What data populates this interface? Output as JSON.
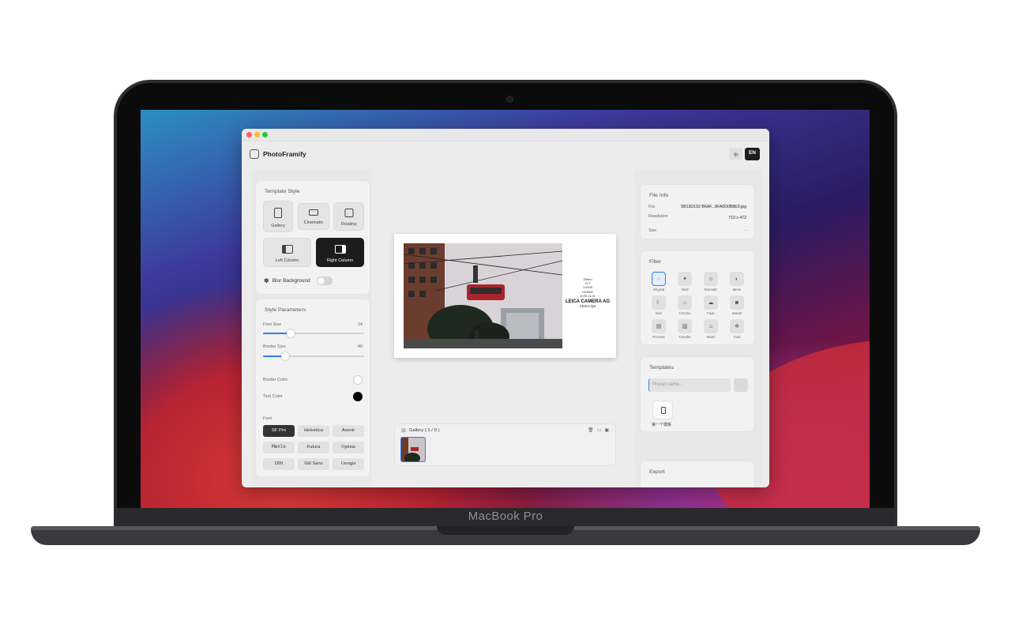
{
  "device": {
    "brand_label": "MacBook Pro"
  },
  "app": {
    "title": "PhotoFramify",
    "lang_zh": "中",
    "lang_en": "EN"
  },
  "template_style": {
    "title": "Template Style",
    "items": [
      {
        "label": "Gallery",
        "selected": false
      },
      {
        "label": "Cinematic",
        "selected": false
      },
      {
        "label": "Floating",
        "selected": false
      },
      {
        "label": "Left Column",
        "selected": false
      },
      {
        "label": "Right Column",
        "selected": true
      }
    ],
    "blur_label": "Blur Background",
    "blur_on": false
  },
  "style_params": {
    "title": "Style Parameters",
    "font_size_label": "Font Size",
    "font_size_value": "24",
    "font_size_fraction": 0.27,
    "border_size_label": "Border Size",
    "border_size_value": "40",
    "border_size_fraction": 0.22,
    "border_color_label": "Border Color",
    "border_color": "#ffffff",
    "text_color_label": "Text Color",
    "text_color": "#000000",
    "font_label": "Font",
    "fonts": [
      "SF Pro",
      "Helvetica",
      "Avenir",
      "Menlo",
      "Futura",
      "Optima",
      "DIN",
      "Gill Sans",
      "Georgia"
    ],
    "selected_font": "SF Pro"
  },
  "preview": {
    "focal": "28mm",
    "aperture": "f/17",
    "shutter": "1/1000",
    "iso": "ISO800",
    "date": "2025.11.01",
    "camera_make": "LEICA CAMERA AG",
    "camera_model": "LEICA Q3"
  },
  "gallery": {
    "title": "Gallery ( 1 / 9 )"
  },
  "file_info": {
    "title": "File Info",
    "file_label": "File",
    "file_value": "5B13D192-B6AF...6FA0D0B8E9.jpg",
    "resolution_label": "Resolution",
    "resolution_value": "710 x 472",
    "size_label": "Size",
    "size_value": "-"
  },
  "filter": {
    "title": "Filter",
    "items": [
      "Original",
      "Vivid",
      "Dramatic",
      "Mono",
      "Noir",
      "Chrome",
      "Fade",
      "Instant",
      "Process",
      "Transfer",
      "Warm",
      "Cool"
    ],
    "selected": "Original"
  },
  "templates": {
    "title": "Templates",
    "preset_placeholder": "Preset name...",
    "items": [
      "第一个模板"
    ]
  },
  "export": {
    "title": "Export"
  },
  "colors": {
    "accent": "#2f7cf6",
    "selected_dark": "#1c1c1c"
  }
}
